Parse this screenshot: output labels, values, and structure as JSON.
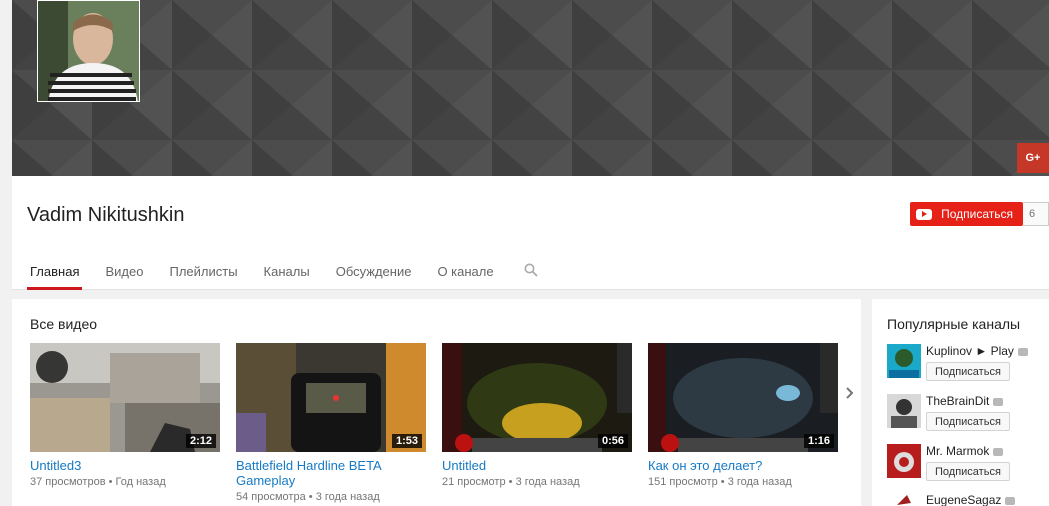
{
  "channel": {
    "name": "Vadim Nikitushkin",
    "subscribe_label": "Подписаться",
    "subscriber_count": "6",
    "gplus_label": "G+"
  },
  "tabs": [
    {
      "label": "Главная",
      "active": true
    },
    {
      "label": "Видео",
      "active": false
    },
    {
      "label": "Плейлисты",
      "active": false
    },
    {
      "label": "Каналы",
      "active": false
    },
    {
      "label": "Обсуждение",
      "active": false
    },
    {
      "label": "О канале",
      "active": false
    }
  ],
  "main": {
    "section_title": "Все видео",
    "videos": [
      {
        "title": "Untitled3",
        "views": "37 просмотров",
        "age": "Год назад",
        "duration": "2:12"
      },
      {
        "title": "Battlefield Hardline BETA Gameplay",
        "views": "54 просмотра",
        "age": "3 года назад",
        "duration": "1:53"
      },
      {
        "title": "Untitled",
        "views": "21 просмотр",
        "age": "3 года назад",
        "duration": "0:56"
      },
      {
        "title": "Как он это делает?",
        "views": "151 просмотр",
        "age": "3 года назад",
        "duration": "1:16"
      }
    ]
  },
  "sidebar": {
    "title": "Популярные каналы",
    "channels": [
      {
        "name": "Kuplinov ► Play",
        "button": "Подписаться"
      },
      {
        "name": "TheBrainDit",
        "button": "Подписаться"
      },
      {
        "name": "Mr. Marmok",
        "button": "Подписаться"
      },
      {
        "name": "EugeneSagaz",
        "button": ""
      }
    ]
  },
  "colors": {
    "accent_red": "#e62117",
    "link_blue": "#167ac6",
    "tab_underline": "#cc181e"
  }
}
